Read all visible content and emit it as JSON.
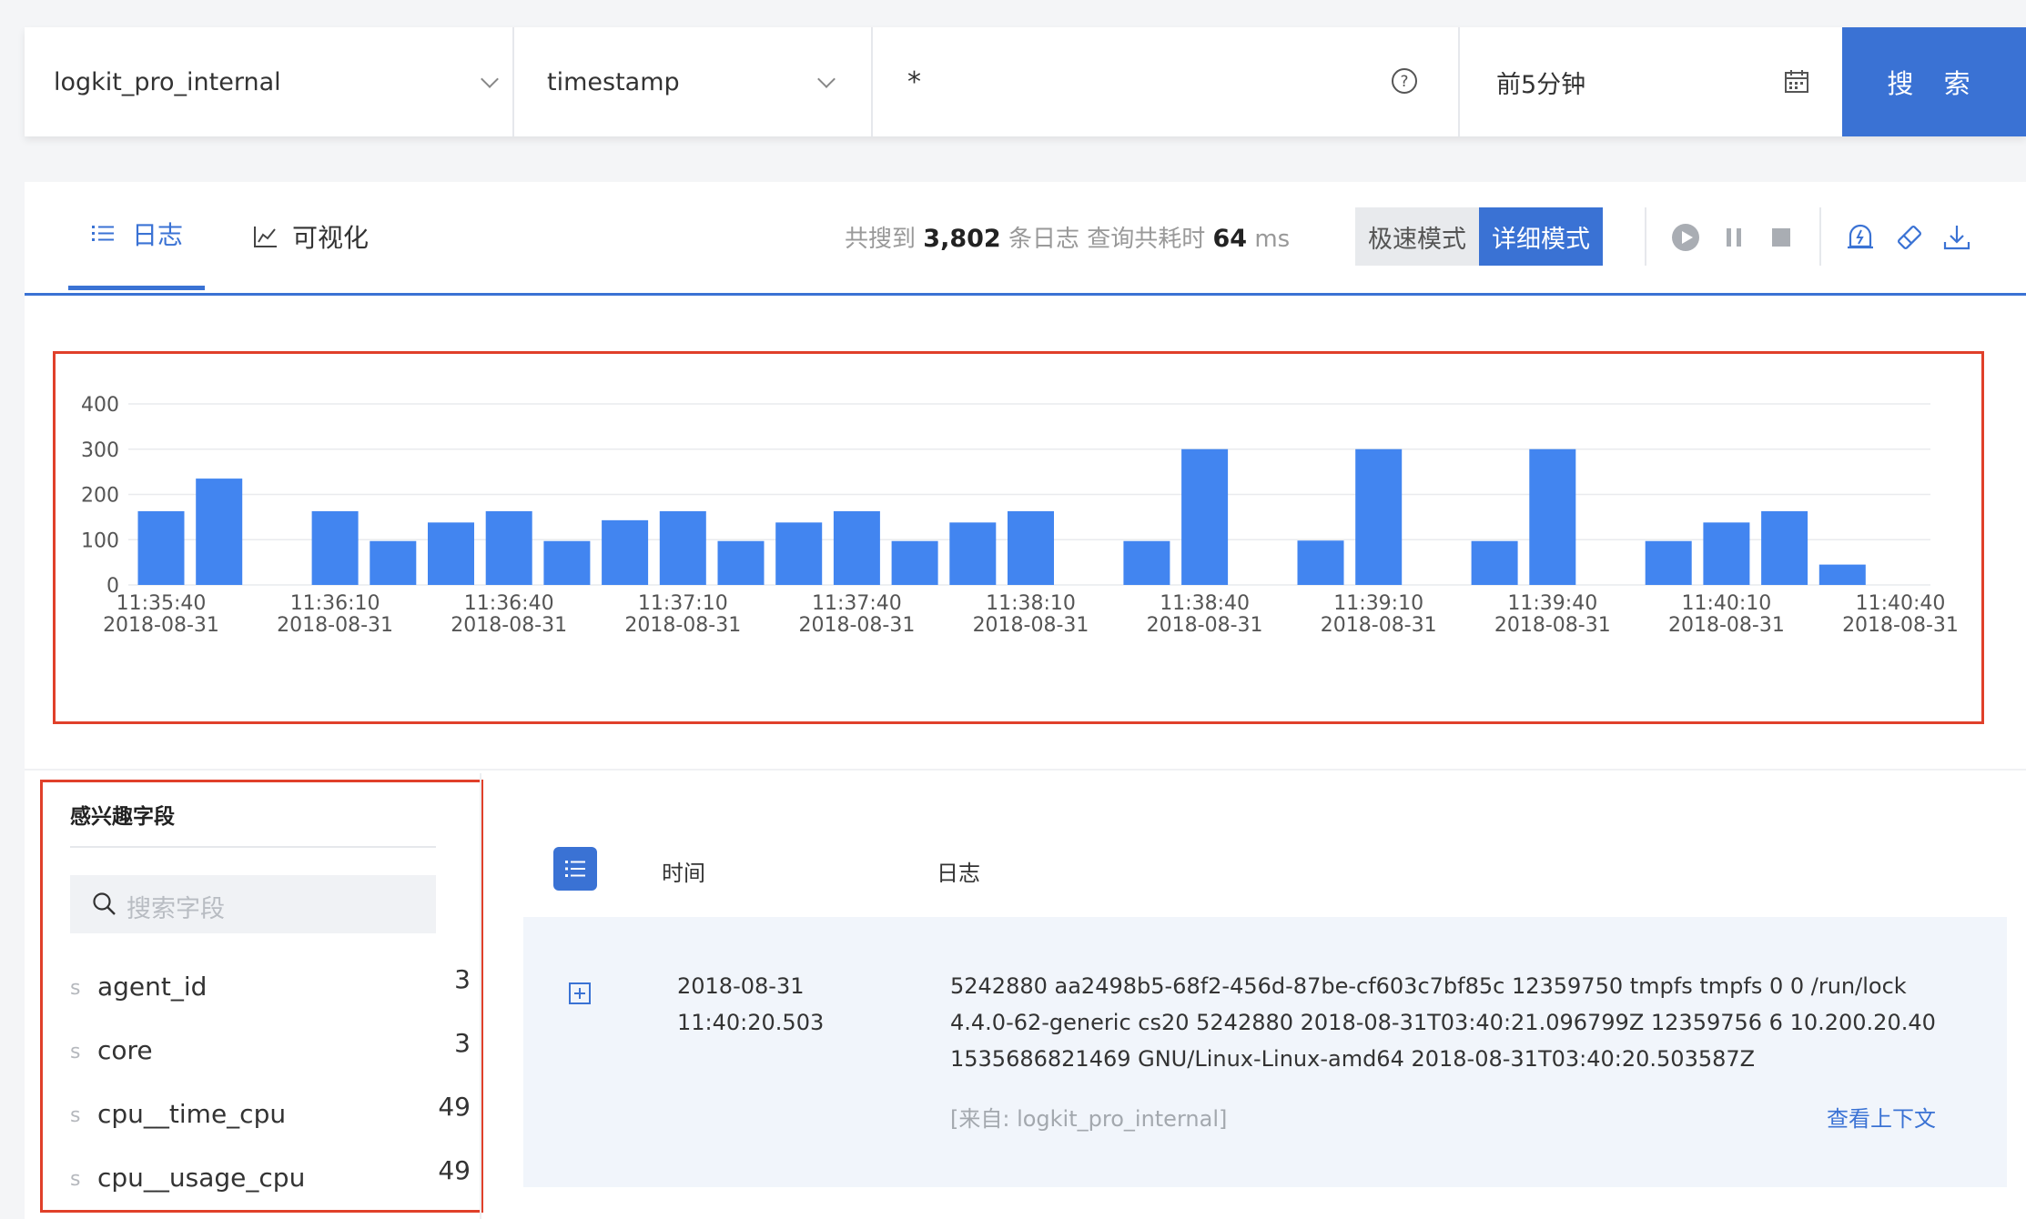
{
  "search": {
    "repo": "logkit_pro_internal",
    "time_field": "timestamp",
    "query": "*",
    "time_range": "前5分钟",
    "button_label": "搜 索"
  },
  "tabs": [
    {
      "label": "日志",
      "icon": "list-icon",
      "active": true
    },
    {
      "label": "可视化",
      "icon": "line-chart-icon",
      "active": false
    }
  ],
  "stats": {
    "prefix": "共搜到",
    "count": "3,802",
    "mid": "条日志 查询共耗时",
    "ms": "64",
    "unit": "ms"
  },
  "modes": {
    "fast": "极速模式",
    "detailed": "详细模式",
    "active": "detailed"
  },
  "toolbar_icons": [
    "play-icon",
    "pause-icon",
    "stop-icon",
    "alert-bell-icon",
    "eraser-icon",
    "download-icon"
  ],
  "colors": {
    "accent": "#3a72d4",
    "bar": "#4285f0",
    "highlight_border": "#e0402a"
  },
  "chart_data": {
    "type": "bar",
    "ylim": [
      0,
      400
    ],
    "y_ticks": [
      "0",
      "100",
      "200",
      "300",
      "400"
    ],
    "grid": true,
    "x_ticks": [
      {
        "time": "11:35:40",
        "date": "2018-08-31"
      },
      {
        "time": "11:36:10",
        "date": "2018-08-31"
      },
      {
        "time": "11:36:40",
        "date": "2018-08-31"
      },
      {
        "time": "11:37:10",
        "date": "2018-08-31"
      },
      {
        "time": "11:37:40",
        "date": "2018-08-31"
      },
      {
        "time": "11:38:10",
        "date": "2018-08-31"
      },
      {
        "time": "11:38:40",
        "date": "2018-08-31"
      },
      {
        "time": "11:39:10",
        "date": "2018-08-31"
      },
      {
        "time": "11:39:40",
        "date": "2018-08-31"
      },
      {
        "time": "11:40:10",
        "date": "2018-08-31"
      },
      {
        "time": "11:40:40",
        "date": "2018-08-31"
      }
    ],
    "categories": [
      "11:35:40",
      "11:35:50",
      "11:36:00",
      "11:36:10",
      "11:36:20",
      "11:36:30",
      "11:36:40",
      "11:36:50",
      "11:37:00",
      "11:37:10",
      "11:37:20",
      "11:37:30",
      "11:37:40",
      "11:37:50",
      "11:38:00",
      "11:38:10",
      "11:38:20",
      "11:38:30",
      "11:38:40",
      "11:38:50",
      "11:39:00",
      "11:39:10",
      "11:39:20",
      "11:39:30",
      "11:39:40",
      "11:39:50",
      "11:40:00",
      "11:40:10",
      "11:40:20",
      "11:40:30",
      "11:40:40"
    ],
    "values": [
      163,
      235,
      0,
      163,
      97,
      138,
      163,
      97,
      143,
      163,
      97,
      138,
      163,
      97,
      138,
      163,
      0,
      97,
      300,
      0,
      98,
      300,
      0,
      97,
      300,
      0,
      97,
      138,
      163,
      45,
      0
    ]
  },
  "fields_panel": {
    "title": "感兴趣字段",
    "search_placeholder": "搜索字段",
    "items": [
      {
        "type": "s",
        "name": "agent_id",
        "count": "3"
      },
      {
        "type": "s",
        "name": "core",
        "count": "3"
      },
      {
        "type": "s",
        "name": "cpu__time_cpu",
        "count": "49"
      },
      {
        "type": "s",
        "name": "cpu__usage_cpu",
        "count": "49"
      }
    ]
  },
  "log_table": {
    "col_time": "时间",
    "col_log": "日志",
    "rows": [
      {
        "date": "2018-08-31",
        "time": "11:40:20.503",
        "lines": [
          "5242880  aa2498b5-68f2-456d-87be-cf603c7bf85c  12359750  tmpfs  tmpfs  0  0  /run/lock",
          "4.4.0-62-generic  cs20  5242880  2018-08-31T03:40:21.096799Z  12359756  6  10.200.20.40",
          "1535686821469  GNU/Linux-Linux-amd64  2018-08-31T03:40:20.503587Z"
        ],
        "source": "[来自: logkit_pro_internal]",
        "context_link": "查看上下文"
      }
    ]
  }
}
